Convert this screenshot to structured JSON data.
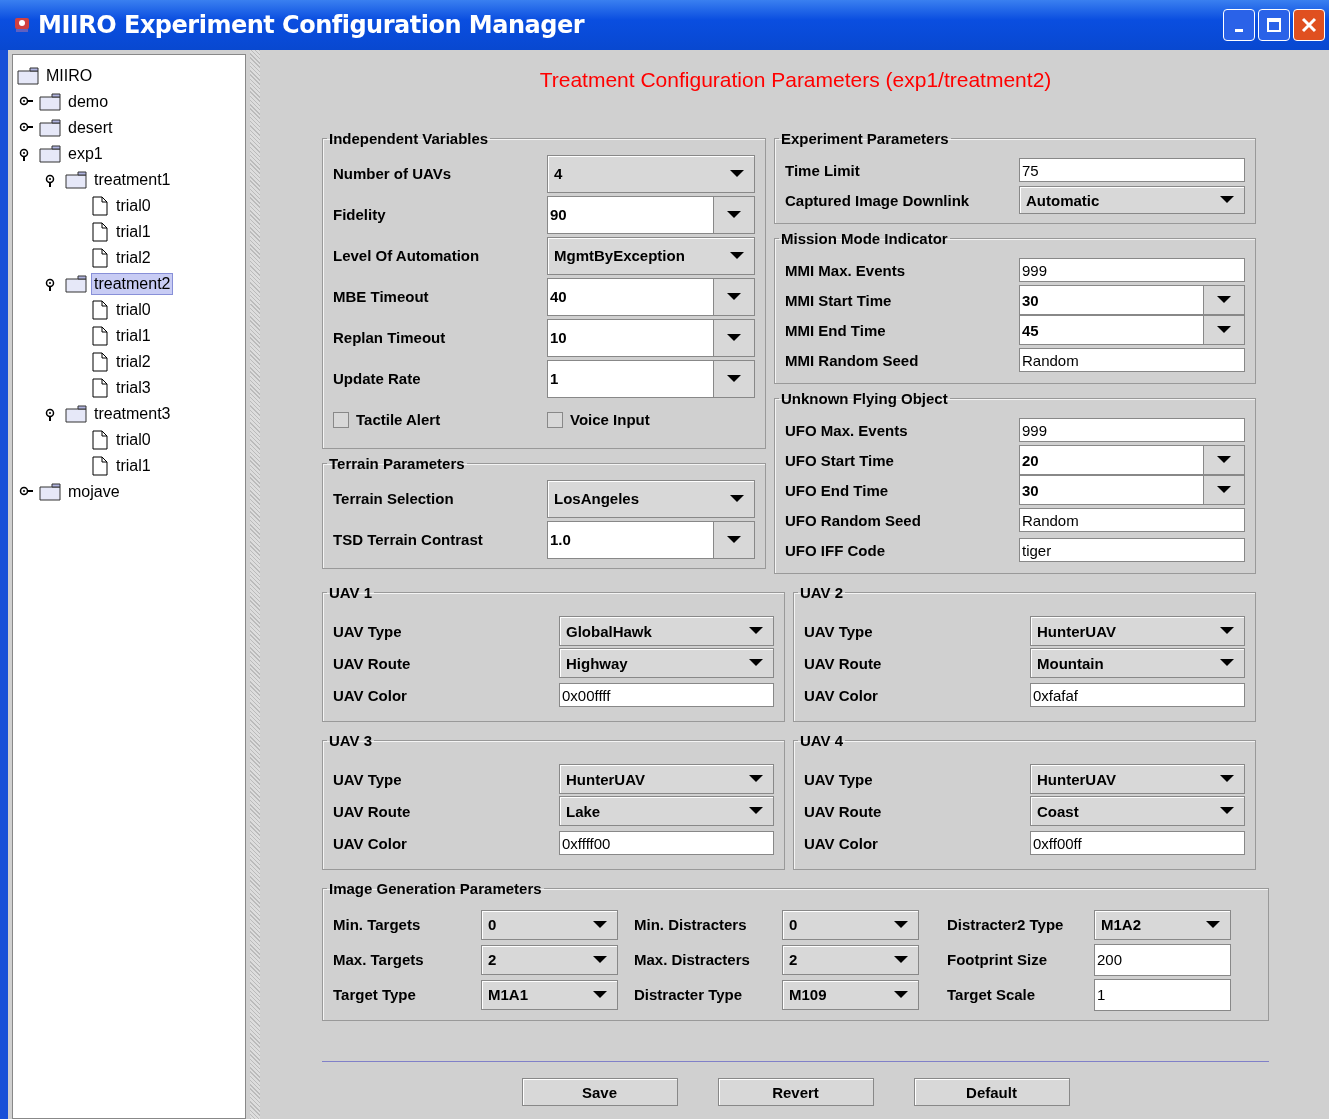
{
  "window": {
    "title": "MIIRO Experiment Configuration Manager"
  },
  "tree": {
    "label": "MIIRO",
    "kind": "folder",
    "selected": false,
    "children": [
      {
        "label": "demo",
        "kind": "folder",
        "expanded": false,
        "selected": false
      },
      {
        "label": "desert",
        "kind": "folder",
        "expanded": false,
        "selected": false
      },
      {
        "label": "exp1",
        "kind": "folder",
        "expanded": true,
        "selected": false,
        "children": [
          {
            "label": "treatment1",
            "kind": "folder",
            "expanded": true,
            "selected": false,
            "children": [
              {
                "label": "trial0",
                "kind": "file",
                "selected": false
              },
              {
                "label": "trial1",
                "kind": "file",
                "selected": false
              },
              {
                "label": "trial2",
                "kind": "file",
                "selected": false
              }
            ]
          },
          {
            "label": "treatment2",
            "kind": "folder",
            "expanded": true,
            "selected": true,
            "children": [
              {
                "label": "trial0",
                "kind": "file",
                "selected": false
              },
              {
                "label": "trial1",
                "kind": "file",
                "selected": false
              },
              {
                "label": "trial2",
                "kind": "file",
                "selected": false
              },
              {
                "label": "trial3",
                "kind": "file",
                "selected": false
              }
            ]
          },
          {
            "label": "treatment3",
            "kind": "folder",
            "expanded": true,
            "selected": false,
            "children": [
              {
                "label": "trial0",
                "kind": "file",
                "selected": false
              },
              {
                "label": "trial1",
                "kind": "file",
                "selected": false
              }
            ]
          }
        ]
      },
      {
        "label": "mojave",
        "kind": "folder",
        "expanded": false,
        "selected": false
      }
    ]
  },
  "heading": "Treatment Configuration Parameters (exp1/treatment2)",
  "left_column": [
    {
      "title": "Independent Variables",
      "fields": [
        {
          "label": "Number of UAVs",
          "kind": "combo",
          "value": "4"
        },
        {
          "label": "Fidelity",
          "kind": "editable",
          "value": "90"
        },
        {
          "label": "Level Of Automation",
          "kind": "combo",
          "value": "MgmtByException"
        },
        {
          "label": "MBE Timeout",
          "kind": "editable",
          "value": "40"
        },
        {
          "label": "Replan Timeout",
          "kind": "editable",
          "value": "10"
        },
        {
          "label": "Update Rate",
          "kind": "editable",
          "value": "1"
        }
      ],
      "checkboxes": [
        {
          "label": "Tactile Alert",
          "checked": false
        },
        {
          "label": "Voice Input",
          "checked": false
        }
      ]
    },
    {
      "title": "Terrain Parameters",
      "fields": [
        {
          "label": "Terrain Selection",
          "kind": "combo",
          "value": "LosAngeles"
        },
        {
          "label": "TSD Terrain Contrast",
          "kind": "editable",
          "value": "1.0"
        }
      ]
    }
  ],
  "right_column": [
    {
      "title": "Experiment Parameters",
      "fields": [
        {
          "label": "Time Limit",
          "kind": "text",
          "value": "75"
        },
        {
          "label": "Captured Image Downlink",
          "kind": "combo",
          "value": "Automatic"
        }
      ]
    },
    {
      "title": "Mission Mode Indicator",
      "fields": [
        {
          "label": "MMI Max. Events",
          "kind": "text",
          "value": "999"
        },
        {
          "label": "MMI Start Time",
          "kind": "editable",
          "value": "30"
        },
        {
          "label": "MMI End Time",
          "kind": "editable",
          "value": "45"
        },
        {
          "label": "MMI Random Seed",
          "kind": "text",
          "value": "Random"
        }
      ]
    },
    {
      "title": "Unknown Flying Object",
      "fields": [
        {
          "label": "UFO Max. Events",
          "kind": "text",
          "value": "999"
        },
        {
          "label": "UFO Start Time",
          "kind": "editable",
          "value": "20"
        },
        {
          "label": "UFO End Time",
          "kind": "editable",
          "value": "30"
        },
        {
          "label": "UFO Random Seed",
          "kind": "text",
          "value": "Random"
        },
        {
          "label": "UFO IFF Code",
          "kind": "text",
          "value": "tiger"
        }
      ]
    }
  ],
  "uav_panels": [
    {
      "title": "UAV 1",
      "fields": [
        {
          "label": "UAV Type",
          "kind": "combo",
          "value": "GlobalHawk"
        },
        {
          "label": "UAV Route",
          "kind": "combo",
          "value": "Highway"
        },
        {
          "label": "UAV Color",
          "kind": "text",
          "value": "0x00ffff"
        }
      ]
    },
    {
      "title": "UAV 2",
      "fields": [
        {
          "label": "UAV Type",
          "kind": "combo",
          "value": "HunterUAV"
        },
        {
          "label": "UAV Route",
          "kind": "combo",
          "value": "Mountain"
        },
        {
          "label": "UAV Color",
          "kind": "text",
          "value": "0xfafaf"
        }
      ]
    },
    {
      "title": "UAV 3",
      "fields": [
        {
          "label": "UAV Type",
          "kind": "combo",
          "value": "HunterUAV"
        },
        {
          "label": "UAV Route",
          "kind": "combo",
          "value": "Lake"
        },
        {
          "label": "UAV Color",
          "kind": "text",
          "value": "0xffff00"
        }
      ]
    },
    {
      "title": "UAV 4",
      "fields": [
        {
          "label": "UAV Type",
          "kind": "combo",
          "value": "HunterUAV"
        },
        {
          "label": "UAV Route",
          "kind": "combo",
          "value": "Coast"
        },
        {
          "label": "UAV Color",
          "kind": "text",
          "value": "0xff00ff"
        }
      ]
    }
  ],
  "image_generation": {
    "title": "Image Generation Parameters",
    "columns": [
      [
        {
          "label": "Min. Targets",
          "kind": "combo",
          "value": "0"
        },
        {
          "label": "Max. Targets",
          "kind": "combo",
          "value": "2"
        },
        {
          "label": "Target Type",
          "kind": "combo",
          "value": "M1A1"
        }
      ],
      [
        {
          "label": "Min. Distracters",
          "kind": "combo",
          "value": "0"
        },
        {
          "label": "Max. Distracters",
          "kind": "combo",
          "value": "2"
        },
        {
          "label": "Distracter Type",
          "kind": "combo",
          "value": "M109"
        }
      ],
      [
        {
          "label": "Distracter2 Type",
          "kind": "combo",
          "value": "M1A2"
        },
        {
          "label": "Footprint Size",
          "kind": "text",
          "value": "200"
        },
        {
          "label": "Target Scale",
          "kind": "text",
          "value": "1"
        }
      ]
    ]
  },
  "buttons": [
    "Save",
    "Revert",
    "Default"
  ]
}
